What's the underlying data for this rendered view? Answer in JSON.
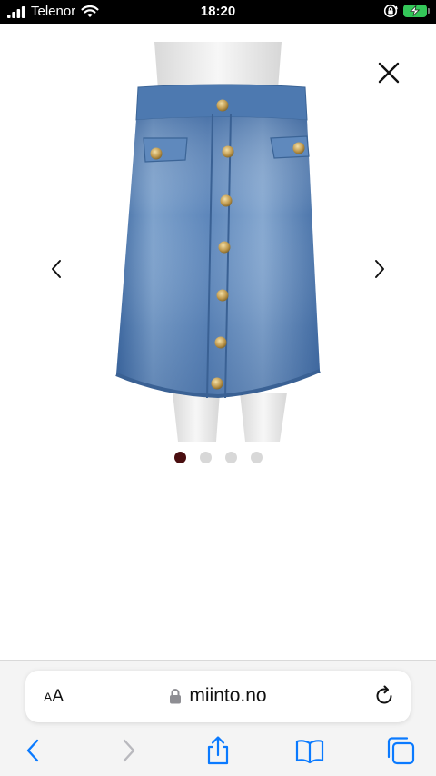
{
  "status_bar": {
    "carrier": "Telenor",
    "time": "18:20",
    "battery_color": "#34c759"
  },
  "viewer": {
    "close_icon": "close-icon",
    "prev_icon": "chevron-left-icon",
    "next_icon": "chevron-right-icon",
    "image_count": 4,
    "active_image": 1,
    "active_dot_color": "#4a0e10",
    "product_description": "denim-button-front-skirt"
  },
  "browser": {
    "text_size_label_small": "A",
    "text_size_label_large": "A",
    "url": "miinto.no",
    "lock_icon": "lock-icon",
    "reload_icon": "reload-icon",
    "toolbar": [
      "back-icon",
      "forward-icon",
      "share-icon",
      "bookmarks-icon",
      "tabs-icon"
    ],
    "accent_color": "#0a7aff"
  }
}
